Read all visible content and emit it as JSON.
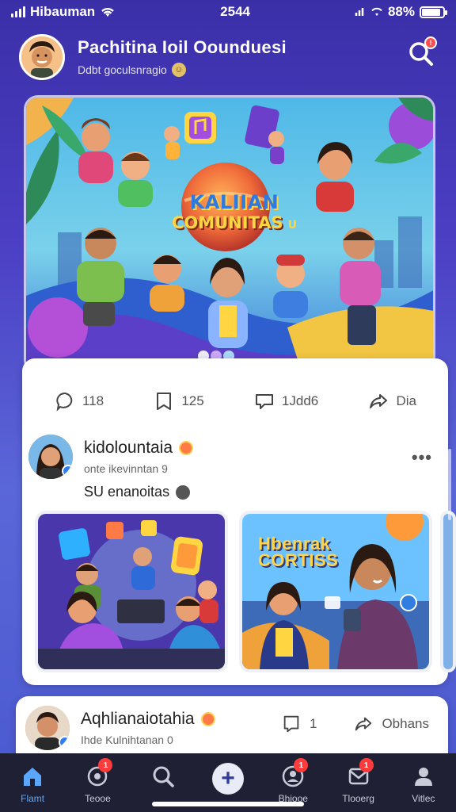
{
  "status_bar": {
    "carrier": "Hibauman",
    "time": "2544",
    "battery": "88%"
  },
  "header": {
    "title": "Pachitina Ioil Oounduesi",
    "subtitle": "Ddbt goculsnragio"
  },
  "hero": {
    "title_line1": "KALIIAN",
    "title_line2": "COMUNITAS",
    "title_suffix": "U"
  },
  "stats": {
    "comments": "118",
    "saves": "125",
    "replies": "1Jdd6",
    "share": "Dia"
  },
  "post": {
    "author": "kidolountaia",
    "time": "onte ikevinntan 9",
    "caption": "SU enanoitas",
    "thumb2_label_line1": "Hbenrak",
    "thumb2_label_line2": "CORTISS"
  },
  "post2": {
    "author": "Aqhlianaiotahia",
    "time": "Ihde Kulnihtanan 0",
    "comments": "1",
    "share": "Obhans"
  },
  "nav": {
    "items": [
      {
        "label": "Flamt",
        "icon": "home-icon",
        "badge": ""
      },
      {
        "label": "Teooe",
        "icon": "target-icon",
        "badge": "1"
      },
      {
        "label": "",
        "icon": "search-icon",
        "badge": ""
      },
      {
        "label": "",
        "icon": "add-icon",
        "badge": ""
      },
      {
        "label": "Bhiooe",
        "icon": "profile-icon",
        "badge": "1"
      },
      {
        "label": "Tlooerg",
        "icon": "inbox-icon",
        "badge": "1"
      },
      {
        "label": "Vitlec",
        "icon": "person-icon",
        "badge": ""
      }
    ]
  },
  "colors": {
    "background_top": "#3b2fa8",
    "background_bottom": "#4a58d0",
    "accent_blue": "#5aa7ff",
    "badge_red": "#ff3b3b",
    "nav_bg": "#1f2033"
  }
}
